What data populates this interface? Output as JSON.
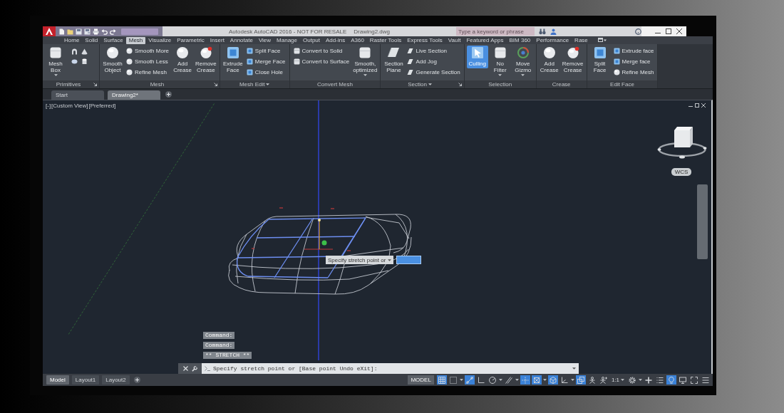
{
  "title_bar": {
    "title": "Autodesk AutoCAD 2016 - NOT FOR RESALE",
    "file": "Drawing2.dwg",
    "search": {
      "placeholder": "Type a keyword or phrase"
    }
  },
  "ribbon": {
    "tabs": [
      {
        "label": "Home",
        "selected": false
      },
      {
        "label": "Solid",
        "selected": false
      },
      {
        "label": "Surface",
        "selected": false
      },
      {
        "label": "Mesh",
        "selected": true
      },
      {
        "label": "Visualize",
        "selected": false
      },
      {
        "label": "Parametric",
        "selected": false
      },
      {
        "label": "Insert",
        "selected": false
      },
      {
        "label": "Annotate",
        "selected": false
      },
      {
        "label": "View",
        "selected": false
      },
      {
        "label": "Manage",
        "selected": false
      },
      {
        "label": "Output",
        "selected": false
      },
      {
        "label": "Add-ins",
        "selected": false
      },
      {
        "label": "A360",
        "selected": false
      },
      {
        "label": "Raster Tools",
        "selected": false
      },
      {
        "label": "Express Tools",
        "selected": false
      },
      {
        "label": "Vault",
        "selected": false
      },
      {
        "label": "Featured Apps",
        "selected": false
      },
      {
        "label": "BIM 360",
        "selected": false
      },
      {
        "label": "Performance",
        "selected": false
      },
      {
        "label": "Rase",
        "selected": false
      }
    ],
    "panels": [
      {
        "title": "Primitives",
        "dropdown": false,
        "launcher": true,
        "items": [
          {
            "kind": "large",
            "label": "Mesh Box",
            "dropdown": true,
            "on": false
          },
          {
            "kind": "icon",
            "on": false
          },
          {
            "kind": "icon",
            "on": false
          },
          {
            "kind": "icon",
            "on": false
          },
          {
            "kind": "icon",
            "on": false
          }
        ]
      },
      {
        "title": "Mesh",
        "dropdown": false,
        "launcher": true,
        "items": [
          {
            "kind": "large",
            "label": "Smooth Object",
            "dropdown": false,
            "on": false
          },
          {
            "kind": "small",
            "label": "Smooth More",
            "on": false
          },
          {
            "kind": "small",
            "label": "Smooth Less",
            "on": false
          },
          {
            "kind": "small",
            "label": "Refine Mesh",
            "on": false
          },
          {
            "kind": "large",
            "label": "Add Crease",
            "dropdown": false,
            "on": false
          },
          {
            "kind": "large",
            "label": "Remove Crease",
            "dropdown": false,
            "on": false
          }
        ]
      },
      {
        "title": "Mesh Edit",
        "dropdown": true,
        "launcher": false,
        "items": [
          {
            "kind": "large",
            "label": "Extrude Face",
            "dropdown": false,
            "on": false
          },
          {
            "kind": "small",
            "label": "Split Face",
            "on": false
          },
          {
            "kind": "small",
            "label": "Merge Face",
            "on": false
          },
          {
            "kind": "small",
            "label": "Close Hole",
            "on": false
          }
        ]
      },
      {
        "title": "Convert Mesh",
        "dropdown": false,
        "launcher": false,
        "items": [
          {
            "kind": "small",
            "label": "Convert to Solid",
            "on": false
          },
          {
            "kind": "small",
            "label": "Convert to Surface",
            "on": false
          },
          {
            "kind": "large",
            "label": "Smooth, optimized",
            "dropdown": true,
            "on": false
          }
        ]
      },
      {
        "title": "Section",
        "dropdown": true,
        "launcher": true,
        "items": [
          {
            "kind": "large",
            "label": "Section Plane",
            "dropdown": false,
            "on": false
          },
          {
            "kind": "small",
            "label": "Live Section",
            "on": false
          },
          {
            "kind": "small",
            "label": "Add Jog",
            "on": false
          },
          {
            "kind": "small",
            "label": "Generate Section",
            "on": false
          }
        ]
      },
      {
        "title": "Selection",
        "dropdown": false,
        "launcher": false,
        "items": [
          {
            "kind": "large",
            "label": "Culling",
            "dropdown": false,
            "on": true
          },
          {
            "kind": "large",
            "label": "No Filter",
            "dropdown": true,
            "on": false
          },
          {
            "kind": "large",
            "label": "Move Gizmo",
            "dropdown": true,
            "on": false
          }
        ]
      },
      {
        "title": "Crease",
        "dropdown": false,
        "launcher": false,
        "items": [
          {
            "kind": "large",
            "label": "Add Crease",
            "dropdown": false,
            "on": false
          },
          {
            "kind": "large",
            "label": "Remove Crease",
            "dropdown": false,
            "on": false
          }
        ]
      },
      {
        "title": "Edit Face",
        "dropdown": false,
        "launcher": false,
        "items": [
          {
            "kind": "large",
            "label": "Split Face",
            "dropdown": false,
            "on": false
          },
          {
            "kind": "small",
            "label": "Extrude face",
            "on": false
          },
          {
            "kind": "small",
            "label": "Merge face",
            "on": false
          },
          {
            "kind": "small",
            "label": "Refine Mesh",
            "on": false
          }
        ]
      }
    ]
  },
  "file_tabs": [
    {
      "label": "Start",
      "selected": false
    },
    {
      "label": "Drawing2*",
      "selected": true
    }
  ],
  "viewport": {
    "view_controls": [
      "[-]",
      "[Custom View]",
      "[Preferred]"
    ],
    "prompt": "Specify stretch point or",
    "coordinate_system": "WCS"
  },
  "command_history": [
    "Command:",
    "Command:",
    "** STRETCH **"
  ],
  "command_line": {
    "prompt": "Specify stretch point or [Base point Undo eXit]:"
  },
  "layout_tabs": [
    {
      "label": "Model",
      "selected": true
    },
    {
      "label": "Layout1",
      "selected": false
    },
    {
      "label": "Layout2",
      "selected": false
    }
  ],
  "status_bar": {
    "model": "MODEL",
    "items": [
      {
        "kind": "grid",
        "on": true,
        "dropdown": false
      },
      {
        "kind": "snap",
        "on": false,
        "dropdown": true
      },
      {
        "kind": "infer",
        "on": true,
        "dropdown": false
      },
      {
        "kind": "ortho",
        "on": false,
        "dropdown": false
      },
      {
        "kind": "polar",
        "on": false,
        "dropdown": true
      },
      {
        "kind": "isodraft",
        "on": false,
        "dropdown": true
      },
      {
        "kind": "track",
        "on": true,
        "dropdown": false
      },
      {
        "kind": "osnap",
        "on": true,
        "dropdown": true
      },
      {
        "kind": "osnap3d",
        "on": true,
        "dropdown": false
      },
      {
        "kind": "dynucs",
        "on": false,
        "dropdown": true
      },
      {
        "kind": "cycle",
        "on": true,
        "dropdown": false
      },
      {
        "kind": "annovisibility",
        "on": false,
        "dropdown": false
      },
      {
        "kind": "autoscale",
        "on": false,
        "dropdown": false
      },
      {
        "kind": "scale",
        "text": "1:1",
        "on": false,
        "dropdown": true
      },
      {
        "kind": "workspace",
        "on": false,
        "dropdown": true
      },
      {
        "kind": "units",
        "on": false,
        "dropdown": false
      },
      {
        "kind": "quickprops",
        "on": false,
        "dropdown": false
      },
      {
        "kind": "isolate",
        "on": true,
        "dropdown": false
      },
      {
        "kind": "hardware",
        "on": false,
        "dropdown": false
      },
      {
        "kind": "fullscreen",
        "on": false,
        "dropdown": false
      },
      {
        "kind": "customize",
        "on": false,
        "dropdown": false
      }
    ]
  }
}
